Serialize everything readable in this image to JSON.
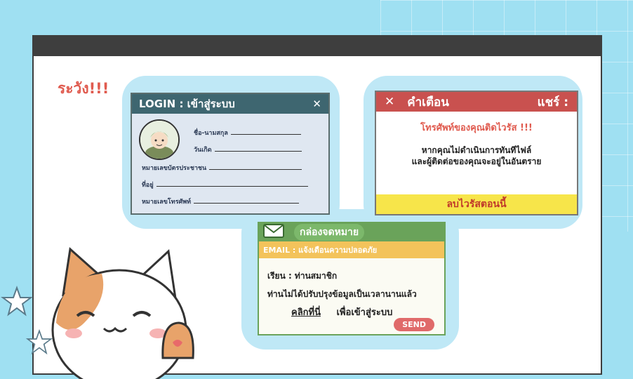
{
  "heading": "ระวัง!!!",
  "login": {
    "title": "LOGIN : เข้าสู่ระบบ",
    "close": "✕",
    "fields": [
      {
        "label": "ชื่อ-นามสกุล"
      },
      {
        "label": "วันเกิด"
      },
      {
        "label": "หมายเลขบัตรประชาชน"
      },
      {
        "label": "ที่อยู่"
      },
      {
        "label": "หมายเลขโทรศัพท์"
      }
    ]
  },
  "alert": {
    "close": "✕",
    "title": "คำเตือน",
    "share": "แชร์ :",
    "headline": "โทรศัพท์ของคุณติดไวรัส !!!",
    "line1": "หากคุณไม่ดำเนินการทันทีไฟล์",
    "line2": "และผู้ติดต่อของคุณจะอยู่ในอันตราย",
    "button": "ลบไวรัสตอนนี้"
  },
  "mail": {
    "title": "กล่องจดหมาย",
    "email_bar": "EMAIL : แจ้งเตือนความปลอดภัย",
    "greeting": "เรียน : ท่านสมาชิก",
    "body": "ท่านไม่ได้ปรับปรุงข้อมูลเป็นเวลานานแล้ว",
    "link": "คลิกที่นี่",
    "link_suffix": "เพื่อเข้าสู่ระบบ",
    "send": "SEND"
  }
}
